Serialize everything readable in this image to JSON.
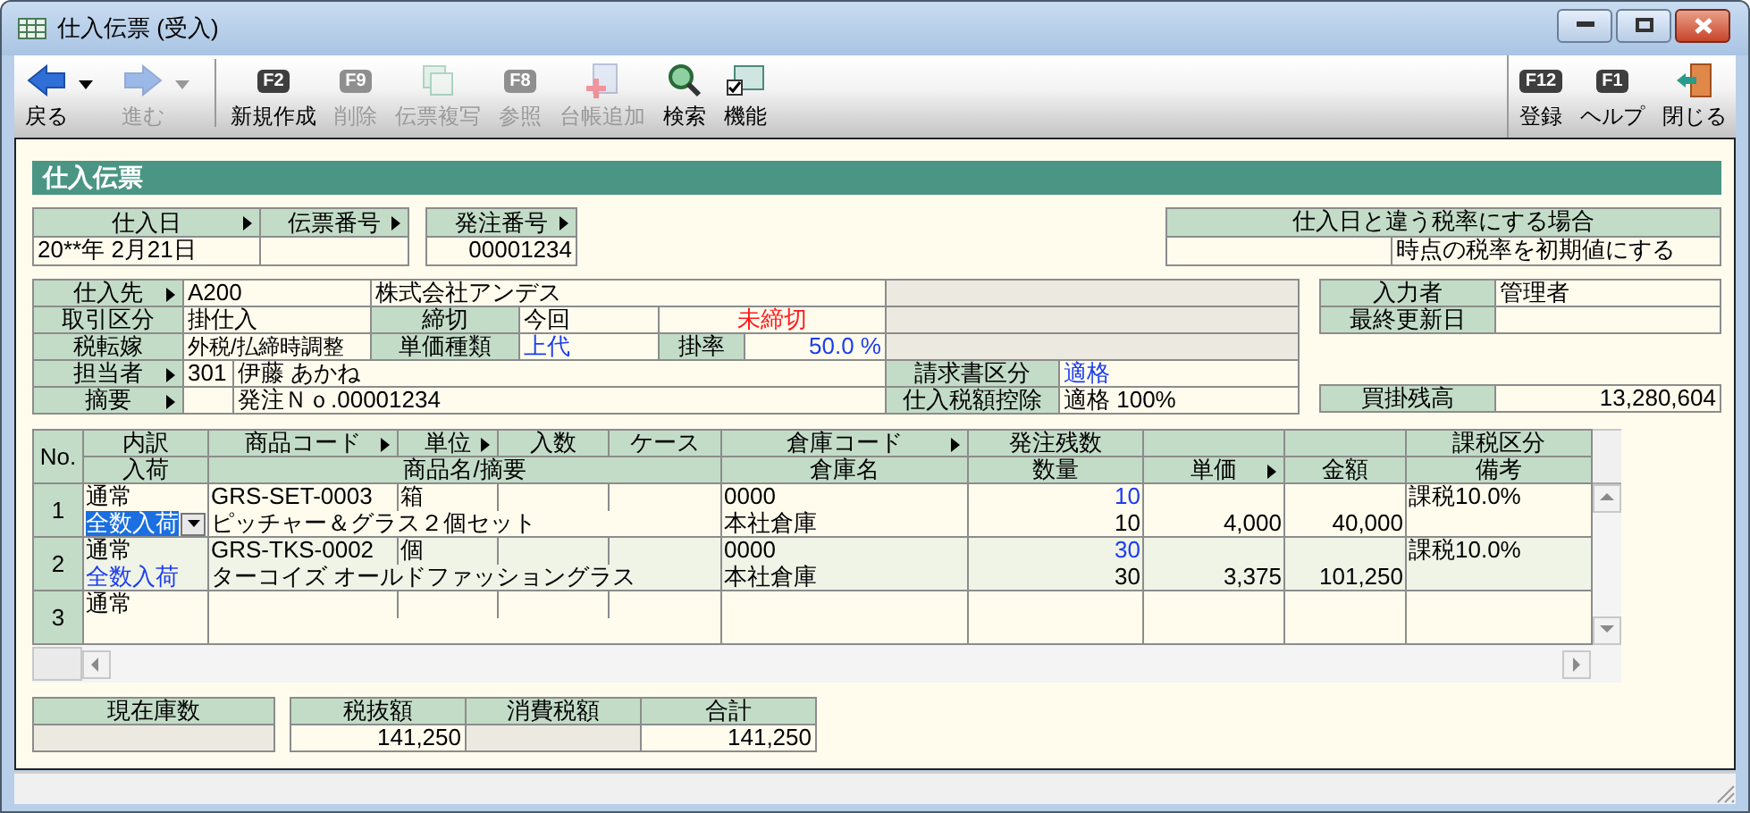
{
  "window": {
    "title": "仕入伝票 (受入)"
  },
  "toolbar": {
    "left": [
      {
        "label": "戻る",
        "disabled": false,
        "dropdown": true
      },
      {
        "label": "進む",
        "disabled": true,
        "dropdown": true
      },
      {
        "label": "新規作成",
        "key": "F2",
        "disabled": false,
        "separator": true
      },
      {
        "label": "削除",
        "key": "F9",
        "disabled": true
      },
      {
        "label": "伝票複写",
        "disabled": true
      },
      {
        "label": "参照",
        "key": "F8",
        "disabled": true
      },
      {
        "label": "台帳追加",
        "disabled": true
      },
      {
        "label": "検索",
        "disabled": false
      },
      {
        "label": "機能",
        "disabled": false
      }
    ],
    "right": [
      {
        "label": "登録",
        "key": "F12",
        "disabled": false
      },
      {
        "label": "ヘルプ",
        "key": "F1",
        "disabled": false
      },
      {
        "label": "閉じる",
        "disabled": false
      }
    ]
  },
  "section_title": "仕入伝票",
  "header": {
    "purchase_date": {
      "label": "仕入日",
      "lookup": true,
      "value": "20**年 2月21日"
    },
    "slip_number": {
      "label": "伝票番号",
      "lookup": true
    },
    "order_number": {
      "label": "発注番号",
      "lookup": true,
      "value": "00001234"
    },
    "tax_rate_note": {
      "label": "仕入日と違う税率にする場合",
      "value": "時点の税率を初期値にする"
    }
  },
  "form": {
    "supplier": {
      "label": "仕入先",
      "lookup": true,
      "code": "A200",
      "name": "株式会社アンデス"
    },
    "trade_type": {
      "label": "取引区分",
      "value": "掛仕入"
    },
    "closing": {
      "label": "締切",
      "value": "今回",
      "status": "未締切"
    },
    "tax_shift": {
      "label": "税転嫁",
      "value": "外税/払締時調整"
    },
    "price_type": {
      "label": "単価種類",
      "value": "上代"
    },
    "rate": {
      "label": "掛率",
      "value": "50.0 %"
    },
    "staff": {
      "label": "担当者",
      "lookup": true,
      "code": "301",
      "name": "伊藤 あかね"
    },
    "memo": {
      "label": "摘要",
      "lookup": true,
      "value": "発注Ｎｏ.00001234"
    },
    "invoice_type": {
      "label": "請求書区分",
      "value": "適格"
    },
    "tax_deduction": {
      "label": "仕入税額控除",
      "value": "適格 100%"
    },
    "entered_by": {
      "label": "入力者",
      "value": "管理者"
    },
    "last_updated": {
      "label": "最終更新日"
    },
    "payable_balance": {
      "label": "買掛残高",
      "value": "13,280,604"
    }
  },
  "table": {
    "header_top": {
      "no": "No.",
      "breakdown": "内訳",
      "product_code": "商品コード",
      "unit": "単位",
      "quantity_per": "入数",
      "case": "ケース",
      "warehouse_code": "倉庫コード",
      "order_remaining": "発注残数",
      "tax_class": "課税区分"
    },
    "header_bottom": {
      "receiving": "入荷",
      "product_name": "商品名/摘要",
      "warehouse_name": "倉庫名",
      "quantity": "数量",
      "unit_price": "単価",
      "amount": "金額",
      "remarks": "備考"
    },
    "rows": [
      {
        "no": "1",
        "breakdown": "通常",
        "receiving": "全数入荷",
        "selected": true,
        "product_code": "GRS-SET-0003",
        "unit": "箱",
        "warehouse_code": "0000",
        "order_remaining": "10",
        "tax_class": "課税10.0%",
        "product_name": "ピッチャー＆グラス２個セット",
        "warehouse_name": "本社倉庫",
        "quantity": "10",
        "unit_price": "4,000",
        "amount": "40,000"
      },
      {
        "no": "2",
        "breakdown": "通常",
        "receiving": "全数入荷",
        "selected": false,
        "product_code": "GRS-TKS-0002",
        "unit": "個",
        "warehouse_code": "0000",
        "order_remaining": "30",
        "tax_class": "課税10.0%",
        "product_name": "ターコイズ オールドファッショングラス",
        "warehouse_name": "本社倉庫",
        "quantity": "30",
        "unit_price": "3,375",
        "amount": "101,250"
      },
      {
        "no": "3",
        "breakdown": "通常",
        "selected": false
      }
    ]
  },
  "totals": {
    "stock": {
      "label": "現在庫数"
    },
    "subtotal": {
      "label": "税抜額",
      "value": "141,250"
    },
    "tax": {
      "label": "消費税額"
    },
    "total": {
      "label": "合計",
      "value": "141,250"
    }
  }
}
